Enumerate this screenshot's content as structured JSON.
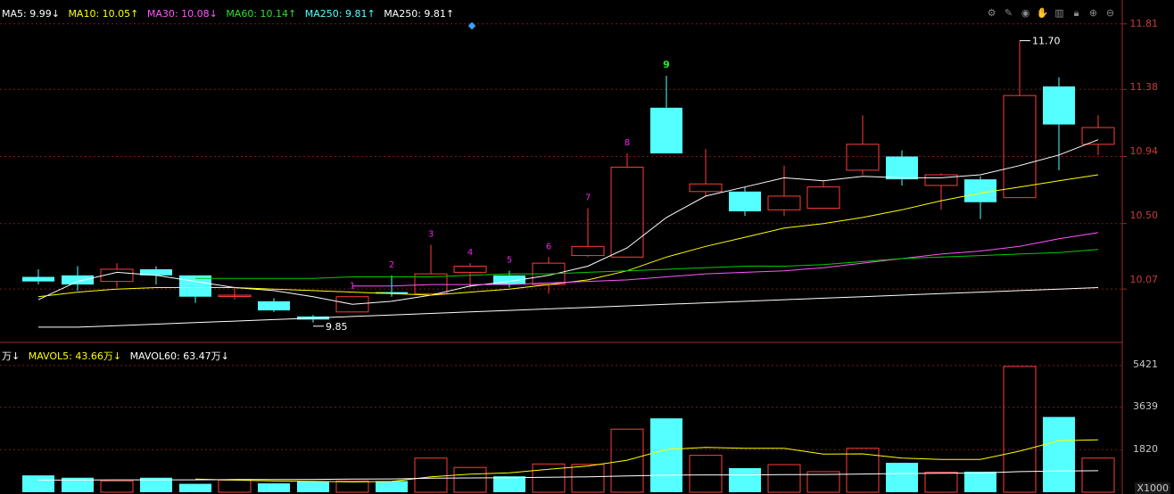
{
  "legend": {
    "ma5": "MA5: 9.99↓",
    "ma10": "MA10: 10.05↑",
    "ma30": "MA30: 10.08↓",
    "ma60": "MA60: 10.14↑",
    "ma250a": "MA250: 9.81↑",
    "ma250b": "MA250: 9.81↑"
  },
  "vol_legend": {
    "vol": "万↓",
    "mavol5": "MAVOL5: 43.66万↓",
    "mavol60": "MAVOL60: 63.47万↓"
  },
  "price_axis": [
    "11.81",
    "11.38",
    "10.94",
    "10.50",
    "10.07"
  ],
  "volume_axis": [
    "5421",
    "3639",
    "1820"
  ],
  "volume_unit": "X1000",
  "annotations": {
    "high": "11.70",
    "low": "9.85"
  },
  "toolbar_icons": [
    "settings-icon",
    "pen-icon",
    "eye-icon",
    "hand-icon",
    "basket-icon",
    "lock-icon",
    "zoom-in-icon",
    "zoom-out-icon"
  ],
  "colors": {
    "up": "#ff3c3c",
    "down": "#54ffff",
    "ma5": "#ffffff",
    "ma10": "#ffff00",
    "ma30": "#ff55ff",
    "ma60": "#00cc00",
    "ma250": "#ffffff",
    "grid": "#7a1a1a"
  },
  "chart_data": {
    "type": "candlestick",
    "ylim": [
      9.72,
      11.92
    ],
    "candles": [
      {
        "o": 10.15,
        "c": 10.12,
        "h": 10.2,
        "l": 10.1,
        "x": 0,
        "label": ""
      },
      {
        "o": 10.16,
        "c": 10.1,
        "h": 10.22,
        "l": 10.06,
        "x": 1,
        "label": ""
      },
      {
        "o": 10.12,
        "c": 10.2,
        "h": 10.24,
        "l": 10.08,
        "x": 2,
        "label": ""
      },
      {
        "o": 10.2,
        "c": 10.16,
        "h": 10.22,
        "l": 10.1,
        "x": 3,
        "label": ""
      },
      {
        "o": 10.16,
        "c": 10.02,
        "h": 10.16,
        "l": 9.98,
        "x": 4,
        "label": ""
      },
      {
        "o": 10.03,
        "c": 10.03,
        "h": 10.08,
        "l": 10.0,
        "x": 5,
        "label": ""
      },
      {
        "o": 9.99,
        "c": 9.93,
        "h": 10.01,
        "l": 9.92,
        "x": 6,
        "label": ""
      },
      {
        "o": 9.89,
        "c": 9.87,
        "h": 9.9,
        "l": 9.85,
        "x": 7,
        "label": ""
      },
      {
        "o": 9.92,
        "c": 10.02,
        "h": 10.02,
        "l": 9.92,
        "x": 8,
        "label": "1"
      },
      {
        "o": 10.05,
        "c": 10.04,
        "h": 10.16,
        "l": 10.02,
        "x": 9,
        "label": "2"
      },
      {
        "o": 10.04,
        "c": 10.17,
        "h": 10.36,
        "l": 10.04,
        "x": 10,
        "label": "3"
      },
      {
        "o": 10.18,
        "c": 10.22,
        "h": 10.24,
        "l": 10.08,
        "x": 11,
        "label": "4"
      },
      {
        "o": 10.16,
        "c": 10.1,
        "h": 10.19,
        "l": 10.08,
        "x": 12,
        "label": "5"
      },
      {
        "o": 10.1,
        "c": 10.24,
        "h": 10.28,
        "l": 10.04,
        "x": 13,
        "label": "6"
      },
      {
        "o": 10.29,
        "c": 10.35,
        "h": 10.6,
        "l": 10.28,
        "x": 14,
        "label": "7"
      },
      {
        "o": 10.28,
        "c": 10.87,
        "h": 10.96,
        "l": 10.28,
        "x": 15,
        "label": "8"
      },
      {
        "o": 11.26,
        "c": 10.96,
        "h": 11.47,
        "l": 10.96,
        "x": 16,
        "label": "9"
      },
      {
        "o": 10.71,
        "c": 10.76,
        "h": 10.99,
        "l": 10.68,
        "x": 17,
        "label": ""
      },
      {
        "o": 10.71,
        "c": 10.58,
        "h": 10.74,
        "l": 10.55,
        "x": 18,
        "label": ""
      },
      {
        "o": 10.59,
        "c": 10.68,
        "h": 10.88,
        "l": 10.55,
        "x": 19,
        "label": ""
      },
      {
        "o": 10.6,
        "c": 10.74,
        "h": 10.78,
        "l": 10.6,
        "x": 20,
        "label": ""
      },
      {
        "o": 10.85,
        "c": 11.02,
        "h": 11.21,
        "l": 10.82,
        "x": 21,
        "label": ""
      },
      {
        "o": 10.94,
        "c": 10.79,
        "h": 10.98,
        "l": 10.75,
        "x": 22,
        "label": ""
      },
      {
        "o": 10.75,
        "c": 10.82,
        "h": 10.83,
        "l": 10.59,
        "x": 23,
        "label": ""
      },
      {
        "o": 10.79,
        "c": 10.64,
        "h": 10.81,
        "l": 10.53,
        "x": 24,
        "label": ""
      },
      {
        "o": 10.67,
        "c": 11.34,
        "h": 11.7,
        "l": 10.67,
        "x": 25,
        "label": ""
      },
      {
        "o": 11.4,
        "c": 11.15,
        "h": 11.46,
        "l": 10.85,
        "x": 26,
        "label": ""
      },
      {
        "o": 11.02,
        "c": 11.13,
        "h": 11.21,
        "l": 10.95,
        "x": 27,
        "label": ""
      }
    ],
    "ma_series": [
      {
        "name": "MA5",
        "color": "#ffffff",
        "values": [
          10.0,
          10.12,
          10.18,
          10.16,
          10.12,
          10.08,
          10.06,
          10.02,
          9.97,
          9.99,
          10.03,
          10.09,
          10.12,
          10.16,
          10.22,
          10.34,
          10.54,
          10.68,
          10.74,
          10.8,
          10.78,
          10.81,
          10.8,
          10.8,
          10.82,
          10.88,
          10.95,
          11.05
        ]
      },
      {
        "name": "MA10",
        "color": "#ffff00",
        "values": [
          10.02,
          10.05,
          10.07,
          10.08,
          10.08,
          10.08,
          10.07,
          10.06,
          10.05,
          10.04,
          10.03,
          10.05,
          10.07,
          10.1,
          10.13,
          10.19,
          10.28,
          10.35,
          10.41,
          10.47,
          10.5,
          10.54,
          10.59,
          10.65,
          10.7,
          10.74,
          10.78,
          10.82
        ]
      },
      {
        "name": "MA30",
        "color": "#ff55ff",
        "values": [
          null,
          null,
          null,
          null,
          null,
          null,
          null,
          null,
          10.09,
          10.09,
          10.1,
          10.1,
          10.1,
          10.11,
          10.12,
          10.13,
          10.15,
          10.17,
          10.18,
          10.19,
          10.21,
          10.24,
          10.27,
          10.3,
          10.32,
          10.35,
          10.4,
          10.44
        ]
      },
      {
        "name": "MA60",
        "color": "#00cc00",
        "values": [
          null,
          null,
          null,
          null,
          10.14,
          10.14,
          10.14,
          10.14,
          10.15,
          10.15,
          10.15,
          10.16,
          10.17,
          10.17,
          10.18,
          10.19,
          10.2,
          10.21,
          10.22,
          10.22,
          10.23,
          10.25,
          10.27,
          10.28,
          10.29,
          10.3,
          10.31,
          10.33
        ]
      },
      {
        "name": "MA250",
        "color": "#ffffff",
        "values": [
          9.82,
          9.82,
          9.83,
          9.84,
          9.85,
          9.86,
          9.87,
          9.88,
          9.89,
          9.9,
          9.91,
          9.92,
          9.93,
          9.94,
          9.95,
          9.96,
          9.97,
          9.98,
          9.99,
          10.0,
          10.01,
          10.02,
          10.03,
          10.04,
          10.05,
          10.06,
          10.07,
          10.08
        ]
      }
    ],
    "volume": {
      "ylim": [
        0,
        5800
      ],
      "values": [
        720,
        620,
        480,
        620,
        360,
        520,
        380,
        460,
        480,
        480,
        1460,
        1060,
        680,
        1210,
        1190,
        2700,
        3160,
        1580,
        1030,
        1180,
        880,
        1880,
        1260,
        860,
        880,
        5380,
        3220,
        1460
      ],
      "mavol5": [
        null,
        null,
        null,
        null,
        560,
        520,
        480,
        470,
        440,
        460,
        660,
        770,
        830,
        980,
        1120,
        1370,
        1830,
        1920,
        1880,
        1880,
        1630,
        1640,
        1460,
        1400,
        1400,
        1760,
        2200,
        2240
      ],
      "mavol60": [
        520,
        520,
        530,
        530,
        530,
        540,
        540,
        550,
        560,
        570,
        600,
        610,
        620,
        640,
        660,
        700,
        730,
        740,
        740,
        750,
        760,
        780,
        800,
        810,
        820,
        880,
        910,
        920
      ]
    }
  }
}
